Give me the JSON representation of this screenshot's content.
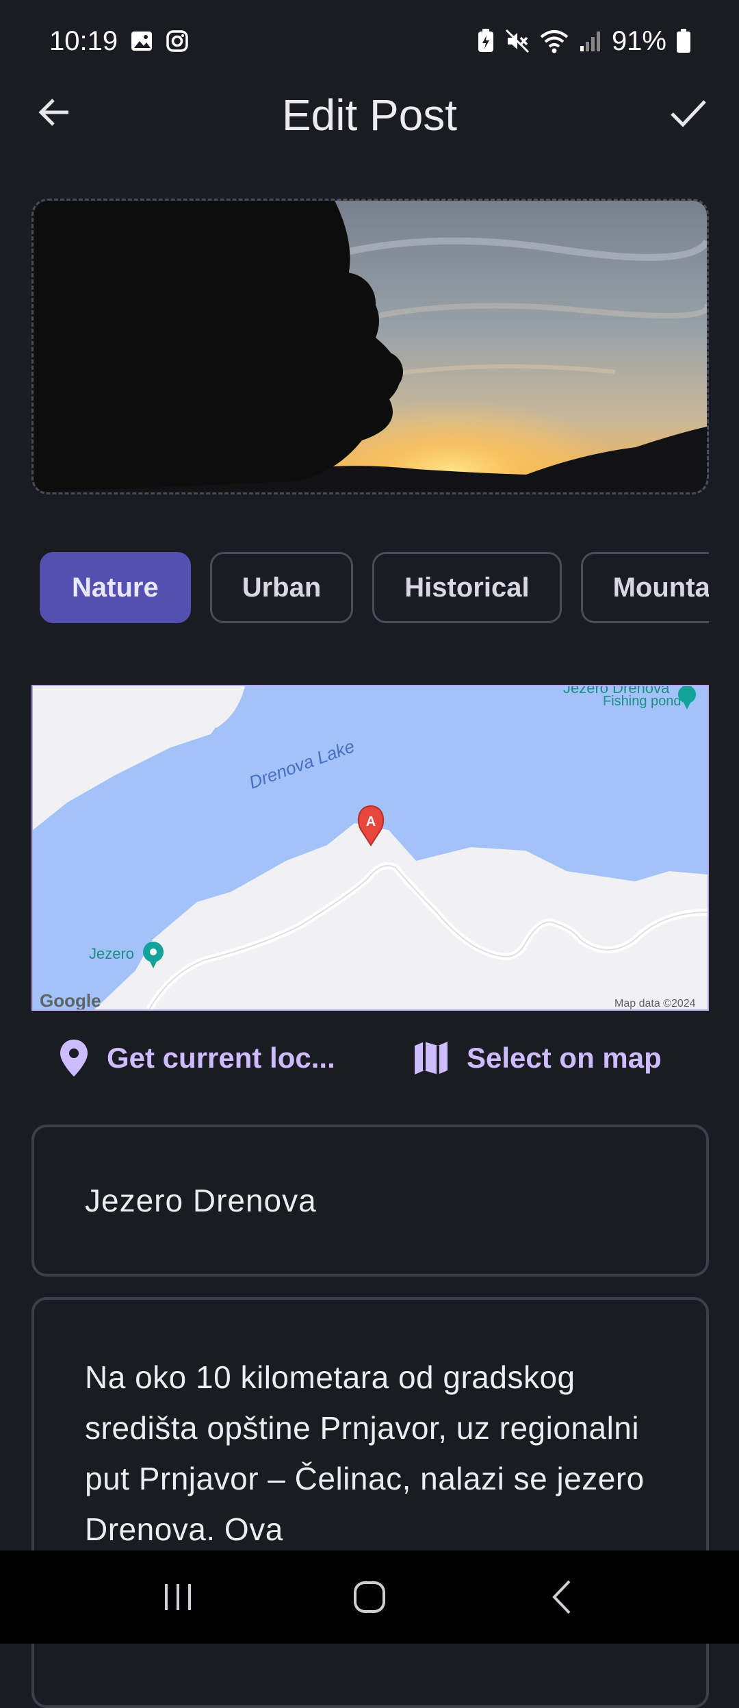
{
  "status_bar": {
    "time": "10:19",
    "battery": "91%",
    "icons_left": [
      "gallery-icon",
      "instagram-icon"
    ],
    "icons_right": [
      "battery-saver-icon",
      "mute-icon",
      "wifi-icon",
      "signal-icon",
      "battery-icon"
    ]
  },
  "app_bar": {
    "title": "Edit Post",
    "back_icon": "arrow-back-icon",
    "confirm_icon": "check-icon"
  },
  "categories": [
    {
      "label": "Nature",
      "selected": true
    },
    {
      "label": "Urban",
      "selected": false
    },
    {
      "label": "Historical",
      "selected": false
    },
    {
      "label": "Mounta",
      "selected": false
    }
  ],
  "map": {
    "lake_label": "Drenova Lake",
    "poi_top_name": "Jezero Drenova",
    "poi_top_type": "Fishing pond",
    "poi_left_name": "Jezero",
    "marker_label": "A",
    "attribution_logo": "Google",
    "attribution": "Map data ©2024",
    "colors": {
      "water": "#a3c2f7",
      "land": "#f1f1f3",
      "road": "#ffffff",
      "marker": "#e8453c",
      "poi": "#14a39a"
    }
  },
  "location_actions": {
    "current": "Get current loc...",
    "select": "Select on map"
  },
  "fields": {
    "name": "Jezero Drenova",
    "description": "Na oko 10 kilometara od gradskog središta opštine Prnjavor, uz regionalni put Prnjavor – Čelinac, nalazi se jezero Drenova. Ova"
  },
  "colors": {
    "background": "#1a1b23",
    "accent": "#5350b0",
    "link": "#cdbcff",
    "border": "#3e3f4b"
  }
}
